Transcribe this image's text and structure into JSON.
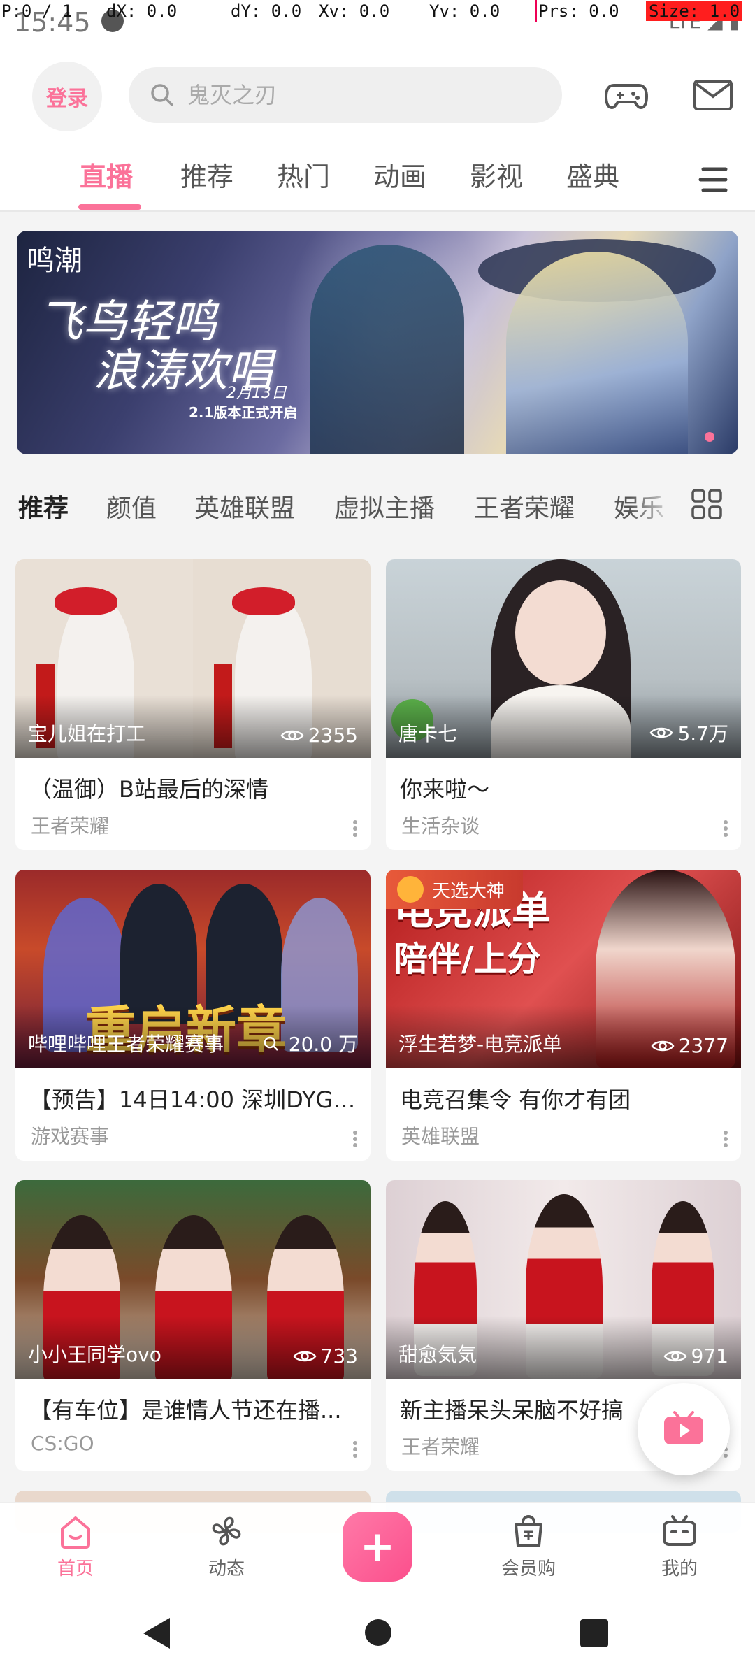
{
  "debug": {
    "p": "P:0 / 1",
    "dx": "dX: 0.0",
    "dy": "dY: 0.0",
    "xv": "Xv: 0.0",
    "yv": "Yv: 0.0",
    "prs": "Prs: 0.0",
    "size": "Size: 1.0"
  },
  "status": {
    "time": "15:45",
    "right": "LTE"
  },
  "header": {
    "login_label": "登录",
    "search_placeholder": "鬼灭之刃",
    "tabs": [
      "直播",
      "推荐",
      "热门",
      "动画",
      "影视",
      "盛典"
    ],
    "active_tab": "直播"
  },
  "banner": {
    "logo_text": "鸣潮",
    "title_line1": "飞鸟轻鸣",
    "title_line2": "浪涛欢唱",
    "date": "2月13日",
    "subtitle": "2.1版本正式开启"
  },
  "categories": [
    "推荐",
    "颜值",
    "英雄联盟",
    "虚拟主播",
    "王者荣耀",
    "娱乐"
  ],
  "cards": [
    {
      "uploader": "宝儿姐在打工",
      "views": "2355",
      "title": "（温御）B站最后的深情",
      "category": "王者荣耀"
    },
    {
      "uploader": "唐卡七",
      "views": "5.7万",
      "title": "你来啦～",
      "category": "生活杂谈"
    },
    {
      "uploader": "哔哩哔哩王者荣耀赛事",
      "views": "20.0 万",
      "title": "【预告】14日14:00 深圳DYG v...",
      "category": "游戏赛事",
      "thumb_text": "重启新章"
    },
    {
      "uploader": "浮生若梦-电竞派单",
      "views": "2377",
      "title": "电竞召集令  有你才有团",
      "category": "英雄联盟",
      "badge": "天选大神",
      "thumb_text1": "电竞派单",
      "thumb_text2": "陪伴/上分"
    },
    {
      "uploader": "小小王同学ovo",
      "views": "733",
      "title": "【有车位】是谁情人节还在播...",
      "category": "CS:GO"
    },
    {
      "uploader": "甜愈気気",
      "views": "971",
      "title": "新主播呆头呆脑不好搞",
      "category": "王者荣耀"
    }
  ],
  "bottom_nav": [
    {
      "label": "首页",
      "icon": "home-icon",
      "active": true
    },
    {
      "label": "动态",
      "icon": "pinwheel-icon",
      "active": false
    },
    {
      "label": "会员购",
      "icon": "shopping-bag-icon",
      "active": false
    },
    {
      "label": "我的",
      "icon": "tv-profile-icon",
      "active": false
    }
  ],
  "colors": {
    "accent": "#fb7299",
    "background": "#f4f4f4"
  }
}
